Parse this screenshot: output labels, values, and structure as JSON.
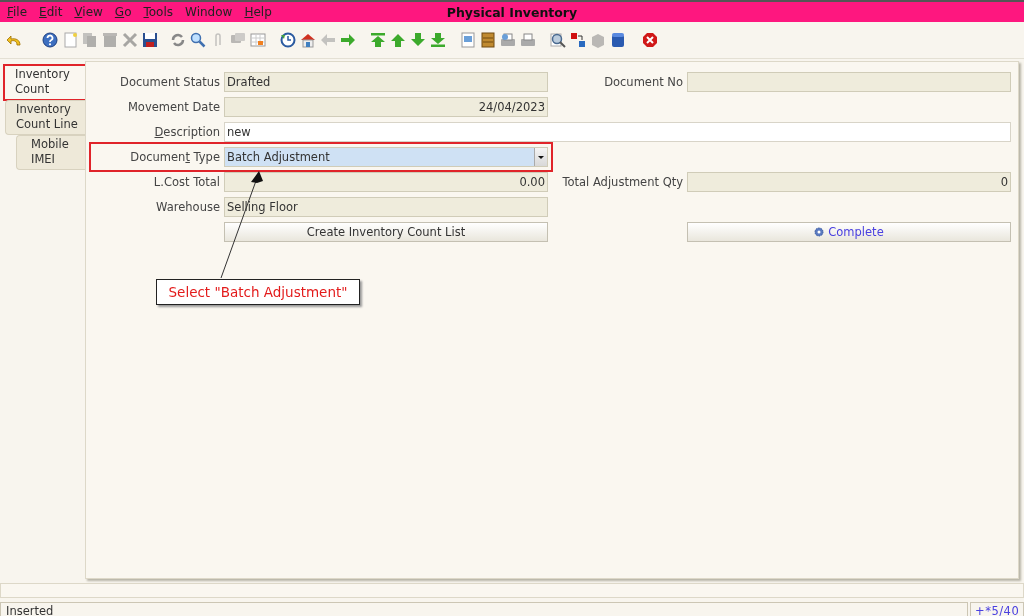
{
  "window": {
    "title": "Physical Inventory"
  },
  "menu": [
    {
      "key": "F",
      "post": "ile"
    },
    {
      "key": "E",
      "post": "dit"
    },
    {
      "key": "V",
      "post": "iew"
    },
    {
      "key": "G",
      "post": "o"
    },
    {
      "key": "T",
      "post": "ools"
    },
    {
      "pre": "Window"
    },
    {
      "key": "H",
      "post": "elp"
    }
  ],
  "toolbar": [
    {
      "disabled": false
    },
    {
      "disabled": false
    },
    {
      "disabled": false
    },
    {
      "disabled": true
    },
    {
      "disabled": true
    },
    {
      "disabled": true
    },
    {
      "disabled": false
    },
    {
      "disabled": false
    },
    {
      "disabled": false
    },
    {
      "disabled": true
    },
    {
      "disabled": true
    },
    {
      "disabled": false
    },
    {
      "disabled": false
    },
    {
      "disabled": false
    },
    {
      "disabled": true
    },
    {
      "disabled": false
    },
    {
      "disabled": false
    },
    {
      "disabled": false
    },
    {
      "disabled": false
    },
    {
      "disabled": false
    },
    {
      "disabled": false
    },
    {
      "disabled": false
    },
    {
      "disabled": false
    },
    {
      "disabled": false
    },
    {
      "disabled": false
    },
    {
      "disabled": false
    },
    {
      "disabled": true
    },
    {
      "disabled": false
    },
    {
      "disabled": false
    }
  ],
  "tabs": [
    {
      "label": "Inventory Count",
      "selected": true,
      "highlighted": true
    },
    {
      "label": "Inventory Count Line",
      "selected": false,
      "highlighted": false,
      "children": [
        {
          "label": "Mobile IMEI",
          "selected": false,
          "highlighted": false
        }
      ]
    }
  ],
  "form": [
    {
      "left": {
        "kind": "readonly",
        "label": {
          "pre": "Document Status"
        },
        "value": "Drafted"
      },
      "right": {
        "kind": "readonly",
        "label": {
          "pre": "Document No"
        }
      }
    },
    {
      "left": {
        "kind": "readonly_number",
        "label": {
          "pre": "Movement Date"
        },
        "value": "24/04/2023"
      }
    },
    {
      "wide": {
        "kind": "text",
        "label": {
          "key": "D",
          "post": "escription"
        },
        "value": "new"
      }
    },
    {
      "left": {
        "kind": "combo",
        "label": {
          "pre": "Documen",
          "key": "t",
          "post": " Type"
        },
        "value": "Batch Adjustment",
        "highlighted": true
      }
    },
    {
      "left": {
        "kind": "readonly_number",
        "label": {
          "pre": "L.Cost Total"
        },
        "value": "0.00"
      },
      "right": {
        "kind": "readonly_number",
        "label": {
          "pre": "Total Adjustment Qty"
        },
        "value": "0"
      }
    },
    {
      "left": {
        "kind": "readonly",
        "label": {
          "pre": "Warehouse"
        },
        "value": "Selling Floor"
      }
    },
    {
      "left": {
        "kind": "button",
        "text": "Create Inventory Count List"
      },
      "right": {
        "kind": "process_button",
        "text": "Complete"
      }
    }
  ],
  "callout": {
    "text": "Select \"Batch Adjustment\""
  },
  "status_bar": {
    "message": "Inserted",
    "record": "+*5/40"
  }
}
